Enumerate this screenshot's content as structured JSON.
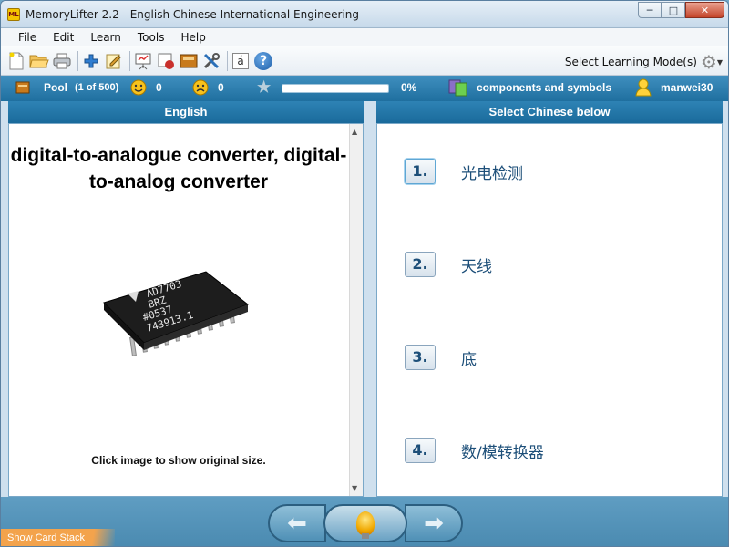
{
  "window": {
    "app_icon_text": "ML",
    "title": "MemoryLifter 2.2 - English Chinese International Engineering",
    "controls": {
      "minimize": "─",
      "maximize": "□",
      "close": "✕"
    }
  },
  "menu": {
    "items": [
      "File",
      "Edit",
      "Learn",
      "Tools",
      "Help"
    ]
  },
  "toolbar": {
    "icons": [
      "new-document-icon",
      "open-folder-icon",
      "print-icon",
      "add-icon",
      "edit-icon",
      "presentation-icon",
      "card-print-icon",
      "box-icon",
      "tools-icon",
      "special-char-icon",
      "help-icon"
    ],
    "special_char": "á",
    "help_symbol": "?",
    "mode_label": "Select Learning Mode(s)"
  },
  "status": {
    "pool_label": "Pool",
    "pool_count": "(1 of 500)",
    "correct_count": "0",
    "wrong_count": "0",
    "progress_percent": "0%",
    "progress_value": 0,
    "category": "components and symbols",
    "user": "manwei30"
  },
  "question": {
    "header": "English",
    "word": "digital-to-analogue converter, digital-to-analog converter",
    "image_alt": "chip",
    "chip_text": [
      "AD7703",
      "BRZ",
      "#0537",
      "743913.1"
    ],
    "hint": "Click image to show original size."
  },
  "answers": {
    "header": "Select Chinese below",
    "choices": [
      {
        "num": "1.",
        "text": "光电检测"
      },
      {
        "num": "2.",
        "text": "天线"
      },
      {
        "num": "3.",
        "text": "底"
      },
      {
        "num": "4.",
        "text": "数/模转换器"
      }
    ]
  },
  "bottom": {
    "prev_symbol": "⬅",
    "next_symbol": "➡",
    "card_stack_link": "Show Card Stack"
  },
  "colors": {
    "accent": "#1f6f9f",
    "progress": "#6bbf4e",
    "card_stack": "#f3a34c"
  }
}
